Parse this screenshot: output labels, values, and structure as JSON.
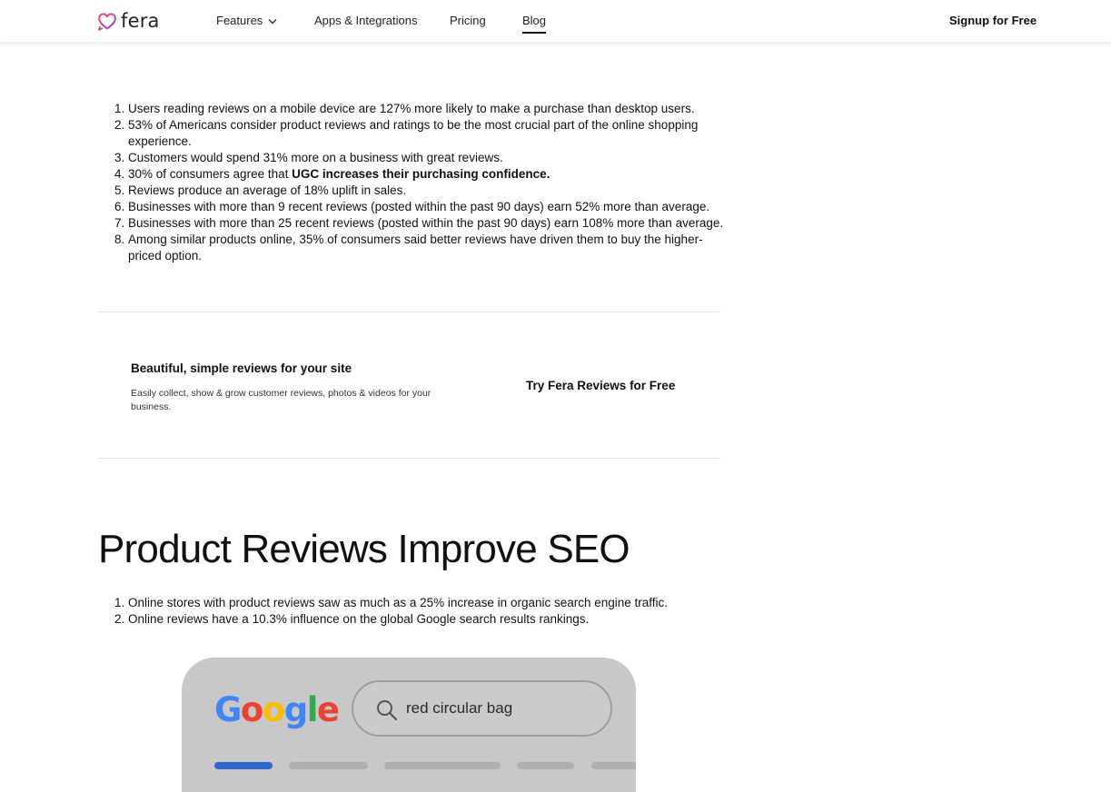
{
  "header": {
    "brand": "fera",
    "nav": {
      "features": "Features",
      "apps": "Apps & Integrations",
      "pricing": "Pricing",
      "blog": "Blog"
    },
    "signup": "Signup for Free"
  },
  "stats_list": [
    "Users reading reviews on a mobile device are 127% more likely to make a purchase than desktop users.",
    "53% of Americans consider product reviews and ratings to be the most crucial part of the online shopping experience.",
    "Customers would spend 31% more on a business with great reviews.",
    {
      "before": "30% of consumers agree that ",
      "bold": "UGC increases their purchasing confidence."
    },
    "Reviews produce an average of 18% uplift in sales.",
    "Businesses with more than 9 recent reviews (posted within the past 90 days) earn 52% more than average.",
    "Businesses with more than 25 recent reviews (posted within the past 90 days) earn 108% more than average.",
    "Among similar products online, 35% of consumers said better reviews have driven them to buy the higher-priced option."
  ],
  "cta": {
    "title": "Beautiful, simple reviews for your site",
    "description": "Easily collect, show & grow customer reviews, photos & videos for your business.",
    "button": "Try Fera Reviews for Free"
  },
  "seo_section": {
    "heading": "Product Reviews Improve SEO",
    "items": [
      "Online stores with product reviews saw as much as a 25% increase in organic search engine traffic.",
      "Online reviews have a 10.3% influence on the global Google search results rankings."
    ]
  },
  "illustration": {
    "logo_letters": [
      "G",
      "o",
      "o",
      "g",
      "l",
      "e"
    ],
    "logo_colors": [
      "#4285F4",
      "#EA4335",
      "#FBBC05",
      "#4285F4",
      "#34A853",
      "#EA4335"
    ],
    "search_query": "red circular bag",
    "search_icon": "search-icon"
  },
  "colors": {
    "brand_gradient_start": "#e8476b",
    "brand_gradient_end": "#8a4bdc",
    "active_tab": "#3366cc",
    "card_bg": "#c8c8c8"
  }
}
